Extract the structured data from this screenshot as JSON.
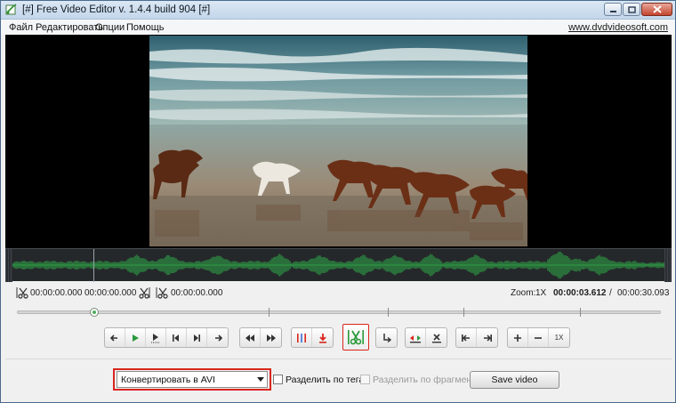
{
  "window": {
    "title": "[#] Free Video Editor v. 1.4.4 build 904 [#]"
  },
  "menu": {
    "items": [
      "Файл",
      "Редактировать",
      "Опции",
      "Помощь"
    ],
    "site_link": "www.dvdvideosoft.com"
  },
  "times": {
    "cut_start": "00:00:00.000",
    "current_mark": "00:00:00.000",
    "cut_end": "00:00:00.000",
    "zoom_label": "Zoom:",
    "zoom_value": "1X",
    "position": "00:00:03.612",
    "slash": "/",
    "duration": "00:00:30.093"
  },
  "timeline": {
    "progress": 0.12
  },
  "toolbar": {
    "zoom_reset_label": "1X"
  },
  "bottom": {
    "convert_option": "Конвертировать в AVI",
    "split_by_tags": "Разделить по тегам",
    "split_by_fragments": "Разделить по фрагментам",
    "save_label": "Save video"
  },
  "colors": {
    "highlight": "#d9261c",
    "play_green": "#2a9a3b",
    "waveform": "#2f9e46"
  },
  "icons": [
    "app-icon",
    "minimize-icon",
    "maximize-icon",
    "close-icon",
    "scissors-icon",
    "arrow-left-icon",
    "play-icon",
    "play-selection-icon",
    "prev-frame-icon",
    "next-frame-icon",
    "arrow-right-icon",
    "go-start-icon",
    "go-end-icon",
    "add-marker-icon",
    "download-icon",
    "split-icon",
    "rotate-icon",
    "color-marker-icon",
    "delete-marker-icon",
    "jump-start-icon",
    "jump-end-icon",
    "zoom-in-icon",
    "zoom-out-icon"
  ]
}
